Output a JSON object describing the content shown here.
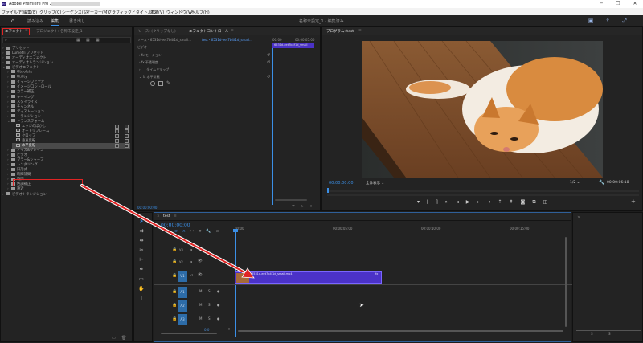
{
  "window": {
    "app_icon": "Pr",
    "title": "Adobe Premiere Pro 2024",
    "minimize": "─",
    "maximize": "❐",
    "close": "✕"
  },
  "menu": {
    "items": [
      "ファイル(F)",
      "編集(E)",
      "クリップ(C)",
      "シーケンス(S)",
      "マーカー(M)",
      "グラフィックとタイトル(G)",
      "表示(V)",
      "ウィンドウ(W)",
      "ヘルプ(H)"
    ]
  },
  "workspace": {
    "tabs": [
      "読み込み",
      "編集",
      "書き出し"
    ],
    "active": "編集",
    "project_title": "名称未設定_1 - 編集済み"
  },
  "effects_panel": {
    "tab_effects": "エフェクト",
    "tab_project": "プロジェクト: 名称未設定_1",
    "tree": [
      {
        "label": "プリセット",
        "indent": 1,
        "icon": "folder",
        "open": false
      },
      {
        "label": "Lumetri プリセット",
        "indent": 1,
        "icon": "folder",
        "open": false
      },
      {
        "label": "オーディオエフェクト",
        "indent": 1,
        "icon": "folder",
        "open": false
      },
      {
        "label": "オーディオトランジション",
        "indent": 1,
        "icon": "folder",
        "open": false
      },
      {
        "label": "ビデオエフェクト",
        "indent": 1,
        "icon": "folder",
        "open": true
      },
      {
        "label": "Obsolete",
        "indent": 2,
        "icon": "folder",
        "open": false
      },
      {
        "label": "Utility",
        "indent": 2,
        "icon": "folder",
        "open": false
      },
      {
        "label": "イマーシブビデオ",
        "indent": 2,
        "icon": "folder",
        "open": false
      },
      {
        "label": "イメージコントロール",
        "indent": 2,
        "icon": "folder",
        "open": false
      },
      {
        "label": "カラー補正",
        "indent": 2,
        "icon": "folder",
        "open": false
      },
      {
        "label": "キーイング",
        "indent": 2,
        "icon": "folder",
        "open": false
      },
      {
        "label": "スタイライズ",
        "indent": 2,
        "icon": "folder",
        "open": false
      },
      {
        "label": "チャンネル",
        "indent": 2,
        "icon": "folder",
        "open": false
      },
      {
        "label": "ディストーション",
        "indent": 2,
        "icon": "folder",
        "open": false
      },
      {
        "label": "トランジション",
        "indent": 2,
        "icon": "folder",
        "open": false
      },
      {
        "label": "トランスフォーム",
        "indent": 2,
        "icon": "folder",
        "open": true
      },
      {
        "label": "エッジのぼかし",
        "indent": 3,
        "icon": "fx",
        "open": false
      },
      {
        "label": "オートリフレーム",
        "indent": 3,
        "icon": "fx",
        "open": false
      },
      {
        "label": "クロップ",
        "indent": 3,
        "icon": "fx",
        "open": false
      },
      {
        "label": "垂直反転",
        "indent": 3,
        "icon": "fx",
        "open": false
      },
      {
        "label": "水平反転",
        "indent": 3,
        "icon": "fx",
        "open": false
      },
      {
        "label": "ノイズ&グレイン",
        "indent": 2,
        "icon": "folder",
        "open": false
      },
      {
        "label": "ビデオ",
        "indent": 2,
        "icon": "folder",
        "open": false
      },
      {
        "label": "ブラー&シャープ",
        "indent": 2,
        "icon": "folder",
        "open": false
      },
      {
        "label": "レンダリング",
        "indent": 2,
        "icon": "folder",
        "open": false
      },
      {
        "label": "旧形式",
        "indent": 2,
        "icon": "folder",
        "open": false
      },
      {
        "label": "時間補間",
        "indent": 2,
        "icon": "folder",
        "open": false
      },
      {
        "label": "時間",
        "indent": 2,
        "icon": "folder",
        "open": false
      },
      {
        "label": "色調補正",
        "indent": 2,
        "icon": "folder",
        "open": false
      },
      {
        "label": "遠近",
        "indent": 2,
        "icon": "folder",
        "open": false
      },
      {
        "label": "ビデオトランジション",
        "indent": 1,
        "icon": "folder",
        "open": false
      }
    ],
    "selected": "水平反転"
  },
  "effect_controls": {
    "tab_source": "ソース: (クリップなし)",
    "tab_effect_controls": "エフェクトコントロール",
    "source_label": "ソース・6531d-eet7b4f1d_small...",
    "seq_label": "test・6531d-eet7b4f1d_small...",
    "ruler_start": "00:00",
    "ruler_end": "00:00:05:00",
    "clip_label": "6531d-eet7b4f1d_small",
    "section_video": "ビデオ",
    "rows": [
      "モーション",
      "不透明度",
      "タイムリマップ",
      "水平反転"
    ],
    "timecode": "00:00:00:00"
  },
  "program_monitor": {
    "tab": "プログラム: test",
    "timecode": "00:00:00:00",
    "fit_label": "全体表示",
    "quality": "1/2",
    "duration": "00:00:06:18"
  },
  "timeline": {
    "tab": "test",
    "timecode": "00:00:00:00",
    "ruler_marks": [
      "00:00",
      "00:00:05:00",
      "00:00:10:00",
      "00:00:15:00"
    ],
    "video_tracks": [
      "V3",
      "V2",
      "V1"
    ],
    "audio_tracks": [
      "A1",
      "A2",
      "A3"
    ],
    "clip_name": "6531d-eet7b4f1d_small.mp4",
    "clip_fx": "fx",
    "mix_label": "0.0",
    "track_toggles": {
      "mute": "M",
      "solo": "S",
      "voice": "●"
    }
  },
  "audio_meter": {
    "scale": [
      "S",
      "S"
    ]
  },
  "colors": {
    "accent_blue": "#3b8fe6",
    "clip_purple": "#4b32c8",
    "highlight_red": "#e02424"
  }
}
